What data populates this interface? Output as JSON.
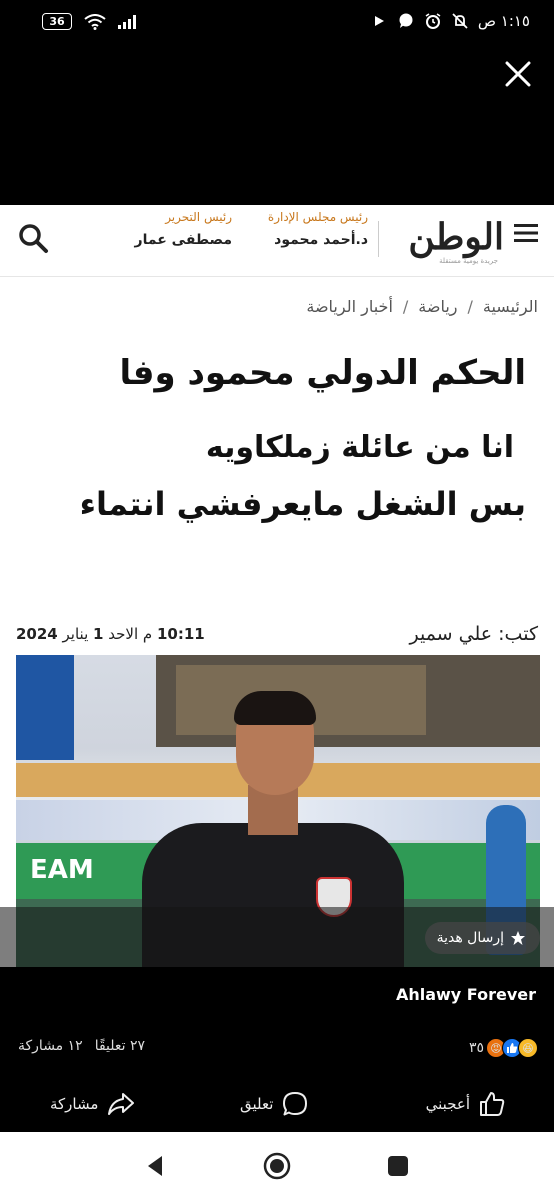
{
  "status_bar": {
    "battery": "36",
    "time": "١:١٥ ص"
  },
  "site": {
    "logo": "الوطن",
    "logo_sub": "جريدة يومية مستقلة",
    "board_chair_label": "رئيس مجلس الإدارة",
    "board_chair_name": "د.أحمد محمود",
    "editor_label": "رئيس التحرير",
    "editor_name": "مصطفى عمار"
  },
  "breadcrumb": {
    "items": [
      "الرئيسية",
      "رياضة",
      "أخبار الرياضة"
    ],
    "separator": "/"
  },
  "article": {
    "headline_1": "الحكم الدولي محمود وفا",
    "headline_2": "انا من عائلة زملكاويه",
    "headline_3": "بس الشغل مايعرفشي انتماء",
    "author_label": "كتب:",
    "author_name": "علي سمير",
    "time": "10:11",
    "ampm": "م",
    "day": "الاحد",
    "day_num": "1",
    "month": "يناير",
    "year": "2024",
    "photo_banner_text": "EAM"
  },
  "gift_button": "إرسال هدية",
  "post": {
    "page_name": "Ahlawy Forever",
    "reactions_count": "٣٥",
    "comments": "٢٧ تعليقًا",
    "shares": "١٢ مشاركة",
    "like_label": "أعجبني",
    "comment_label": "تعليق",
    "share_label": "مشاركة"
  },
  "colors": {
    "accent_label": "#c8781d",
    "like_blue": "#1877f2"
  }
}
